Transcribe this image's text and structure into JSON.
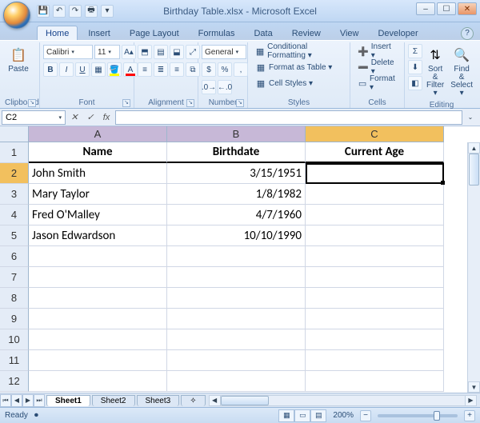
{
  "window": {
    "title": "Birthday Table.xlsx - Microsoft Excel",
    "min": "–",
    "max": "☐",
    "close": "✕"
  },
  "qat": {
    "save": "💾",
    "undo": "↶",
    "redo": "↷",
    "print": "🖶",
    "more": "▾"
  },
  "tabs": [
    "Home",
    "Insert",
    "Page Layout",
    "Formulas",
    "Data",
    "Review",
    "View",
    "Developer"
  ],
  "ribbon": {
    "clipboard": {
      "label": "Clipboard",
      "paste": "Paste"
    },
    "font": {
      "label": "Font",
      "name": "Calibri",
      "size": "11"
    },
    "alignment": {
      "label": "Alignment"
    },
    "number": {
      "label": "Number",
      "format": "General"
    },
    "styles": {
      "label": "Styles",
      "cond": "Conditional Formatting ▾",
      "fmt": "Format as Table ▾",
      "cell": "Cell Styles ▾"
    },
    "cells": {
      "label": "Cells",
      "insert": "Insert ▾",
      "delete": "Delete ▾",
      "format": "Format ▾"
    },
    "editing": {
      "label": "Editing",
      "sort": "Sort & Filter ▾",
      "find": "Find & Select ▾"
    }
  },
  "namebox": "C2",
  "grid": {
    "cols": [
      "A",
      "B",
      "C"
    ],
    "headers": [
      "Name",
      "Birthdate",
      "Current Age"
    ],
    "rows": [
      {
        "n": "2",
        "a": "John Smith",
        "b": "3/15/1951",
        "c": ""
      },
      {
        "n": "3",
        "a": "Mary Taylor",
        "b": "1/8/1982",
        "c": ""
      },
      {
        "n": "4",
        "a": "Fred O'Malley",
        "b": "4/7/1960",
        "c": ""
      },
      {
        "n": "5",
        "a": "Jason Edwardson",
        "b": "10/10/1990",
        "c": ""
      }
    ],
    "empty": [
      "6",
      "7",
      "8",
      "9",
      "10",
      "11",
      "12"
    ]
  },
  "sheets": [
    "Sheet1",
    "Sheet2",
    "Sheet3"
  ],
  "status": {
    "ready": "Ready",
    "zoom": "200%"
  },
  "chart_data": {
    "type": "table",
    "columns": [
      "Name",
      "Birthdate",
      "Current Age"
    ],
    "rows": [
      [
        "John Smith",
        "3/15/1951",
        ""
      ],
      [
        "Mary Taylor",
        "1/8/1982",
        ""
      ],
      [
        "Fred O'Malley",
        "4/7/1960",
        ""
      ],
      [
        "Jason Edwardson",
        "10/10/1990",
        ""
      ]
    ]
  }
}
